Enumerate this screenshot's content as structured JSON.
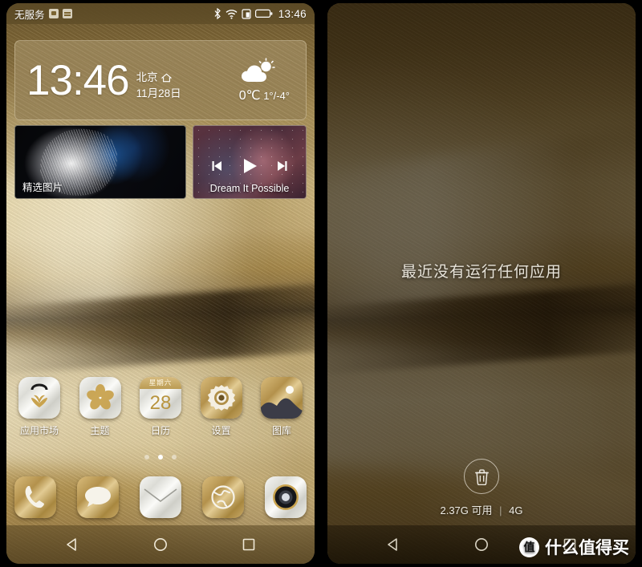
{
  "home": {
    "status_bar": {
      "carrier": "无服务",
      "time": "13:46",
      "icons": [
        "notification-icon-1",
        "notification-icon-2",
        "bluetooth-icon",
        "wifi-icon",
        "sim-card-icon",
        "battery-icon"
      ]
    },
    "clock_widget": {
      "time": "13:46",
      "city": "北京",
      "date": "11月28日",
      "weather_icon": "partly-cloudy-icon",
      "current_temp": "0℃",
      "range_temp": "1°/-4°"
    },
    "widgets": [
      {
        "name": "精选图片",
        "type": "featured-pictures"
      },
      {
        "name": "Dream It Possible",
        "type": "music-player",
        "controls": [
          "previous-track",
          "play",
          "next-track"
        ]
      }
    ],
    "apps": [
      {
        "label": "应用市场",
        "icon": "app-market-icon"
      },
      {
        "label": "主题",
        "icon": "themes-icon"
      },
      {
        "label": "日历",
        "icon": "calendar-icon",
        "weekday": "星期六",
        "day": "28"
      },
      {
        "label": "设置",
        "icon": "settings-gear-icon"
      },
      {
        "label": "图库",
        "icon": "gallery-icon"
      }
    ],
    "page_dots": {
      "count": 3,
      "active": 2
    },
    "dock": [
      {
        "label": "电话",
        "icon": "phone-icon"
      },
      {
        "label": "信息",
        "icon": "message-icon"
      },
      {
        "label": "邮件",
        "icon": "email-icon"
      },
      {
        "label": "浏览器",
        "icon": "browser-globe-icon"
      },
      {
        "label": "相机",
        "icon": "camera-icon"
      }
    ],
    "nav_bar": {
      "back": "back-triangle-icon",
      "home": "home-circle-icon",
      "recents": "recents-square-icon"
    }
  },
  "recents": {
    "empty_message": "最近没有运行任何应用",
    "clear_button_icon": "trash-icon",
    "memory_available": "2.37G 可用",
    "memory_total": "4G",
    "nav_bar": {
      "back": "back-triangle-icon",
      "home": "home-circle-icon",
      "recents": "recents-square-icon"
    }
  },
  "watermark": {
    "badge": "值",
    "text": "什么值得买"
  },
  "colors": {
    "gold": "#c9a95f",
    "dark_gold": "#6d5327",
    "highlight": "#f2e3b8",
    "white": "#ffffff"
  }
}
